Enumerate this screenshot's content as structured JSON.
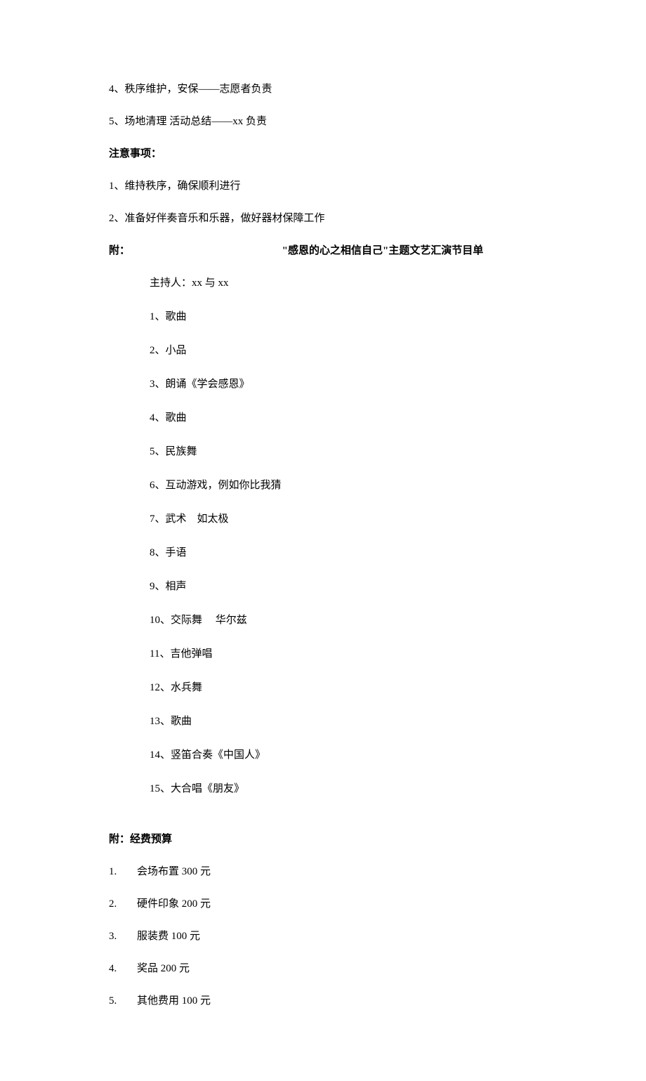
{
  "items": {
    "i4": "4、秩序维护，安保——志愿者负责",
    "i5": "5、场地清理 活动总结——xx 负责"
  },
  "notes": {
    "heading": "注意事项：",
    "n1": "1、维持秩序，确保顺利进行",
    "n2": "2、准备好伴奏音乐和乐器，做好器材保障工作"
  },
  "appendix": {
    "prefix": "附：",
    "title": "\"感恩的心之相信自己\"主题文艺汇演节目单",
    "host": "主持人：xx 与 xx",
    "programs": {
      "p1": "1、歌曲",
      "p2": "2、小品",
      "p3": "3、朗诵《学会感恩》",
      "p4": "4、歌曲",
      "p5": "5、民族舞",
      "p6": "6、互动游戏，例如你比我猜",
      "p7": "7、武术　如太极",
      "p8": "8、手语",
      "p9": "9、相声",
      "p10": "10、交际舞　 华尔兹",
      "p11": "11、吉他弹唱",
      "p12": "12、水兵舞",
      "p13": "13、歌曲",
      "p14": "14、竖笛合奏《中国人》",
      "p15": "15、大合唱《朋友》"
    }
  },
  "budget": {
    "heading": "附：经费预算",
    "items": {
      "b1": {
        "num": "1.",
        "text": "会场布置 300 元"
      },
      "b2": {
        "num": "2.",
        "text": "硬件印象 200 元"
      },
      "b3": {
        "num": "3.",
        "text": "服装费 100 元"
      },
      "b4": {
        "num": "4.",
        "text": "奖品 200 元"
      },
      "b5": {
        "num": "5.",
        "text": "其他费用 100 元"
      }
    }
  }
}
